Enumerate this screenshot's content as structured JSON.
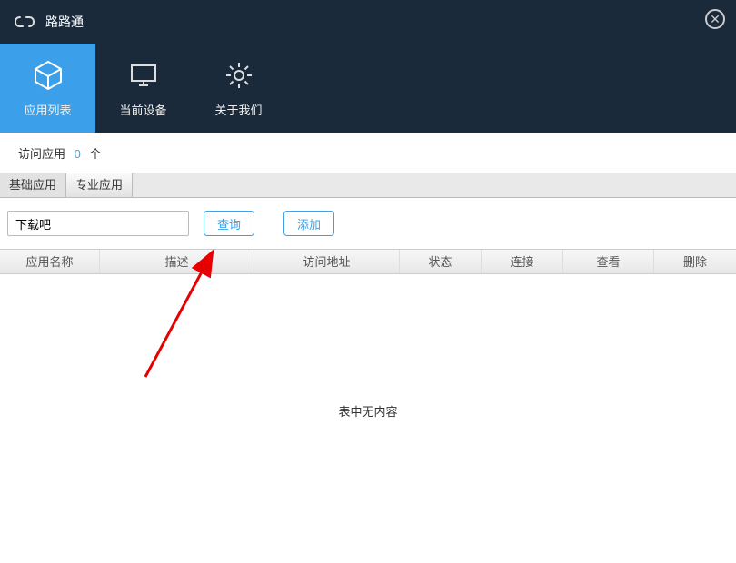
{
  "window": {
    "title": "路路通"
  },
  "nav": {
    "items": [
      {
        "label": "应用列表"
      },
      {
        "label": "当前设备"
      },
      {
        "label": "关于我们"
      }
    ]
  },
  "stats": {
    "label_prefix": "访问应用",
    "count": "0",
    "label_suffix": "个"
  },
  "tabs": {
    "items": [
      {
        "label": "基础应用"
      },
      {
        "label": "专业应用"
      }
    ]
  },
  "search": {
    "value": "下载吧",
    "query_btn": "查询",
    "add_btn": "添加"
  },
  "table": {
    "headers": {
      "name": "应用名称",
      "desc": "描述",
      "url": "访问地址",
      "status": "状态",
      "conn": "连接",
      "view": "查看",
      "del": "删除"
    },
    "empty_text": "表中无内容"
  }
}
